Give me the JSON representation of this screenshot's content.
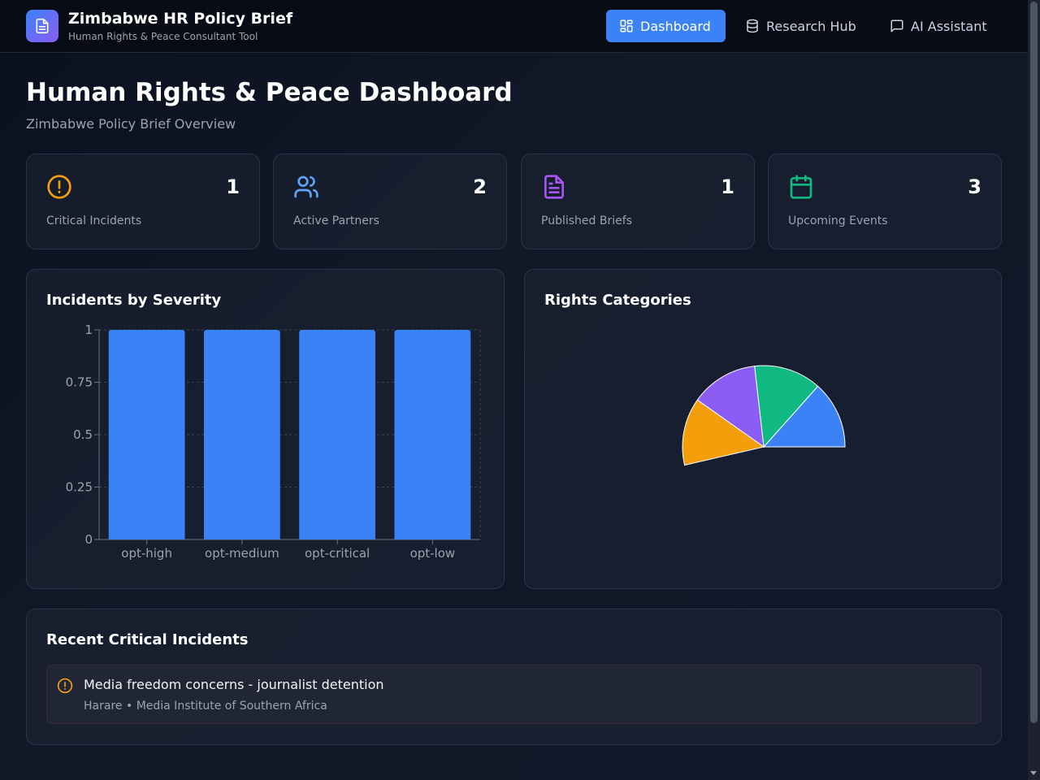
{
  "header": {
    "app_title": "Zimbabwe HR Policy Brief",
    "app_subtitle": "Human Rights & Peace Consultant Tool",
    "logo_icon": "document-icon",
    "nav": [
      {
        "label": "Dashboard",
        "icon": "grid-icon",
        "active": true
      },
      {
        "label": "Research Hub",
        "icon": "database-icon",
        "active": false
      },
      {
        "label": "AI Assistant",
        "icon": "chat-icon",
        "active": false
      }
    ]
  },
  "page": {
    "title": "Human Rights & Peace Dashboard",
    "subtitle": "Zimbabwe Policy Brief Overview"
  },
  "stats": [
    {
      "value": "1",
      "label": "Critical Incidents",
      "icon": "alert-circle-icon",
      "color": "#f59e0b"
    },
    {
      "value": "2",
      "label": "Active Partners",
      "icon": "users-icon",
      "color": "#60a5fa"
    },
    {
      "value": "1",
      "label": "Published Briefs",
      "icon": "file-text-icon",
      "color": "#a855f7"
    },
    {
      "value": "3",
      "label": "Upcoming Events",
      "icon": "calendar-icon",
      "color": "#10b981"
    }
  ],
  "panels": {
    "severity_title": "Incidents by Severity",
    "categories_title": "Rights Categories",
    "recent_title": "Recent Critical Incidents"
  },
  "chart_data": [
    {
      "type": "bar",
      "title": "Incidents by Severity",
      "categories": [
        "opt-high",
        "opt-medium",
        "opt-critical",
        "opt-low"
      ],
      "values": [
        1,
        1,
        1,
        1
      ],
      "ylim": [
        0,
        1
      ],
      "yticks": [
        "0",
        "0.25",
        "0.5",
        "0.75",
        "1"
      ],
      "grid": true,
      "color": "#3b82f6"
    },
    {
      "type": "pie",
      "title": "Rights Categories",
      "start_angle_deg": 0,
      "end_angle_deg": 193,
      "values": [
        1,
        1,
        1,
        1
      ],
      "colors": [
        "#3b82f6",
        "#10b981",
        "#8b5cf6",
        "#f59e0b"
      ]
    }
  ],
  "recent_incidents": [
    {
      "title": "Media freedom concerns - journalist detention",
      "location": "Harare",
      "separator": "•",
      "source": "Media Institute of Southern Africa",
      "icon": "alert-circle-icon"
    }
  ]
}
